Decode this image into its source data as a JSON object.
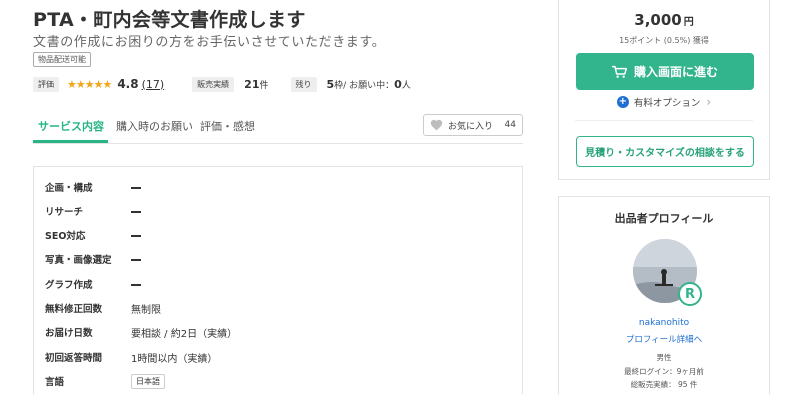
{
  "service": {
    "title": "PTA・町内会等文書作成します",
    "subtitle": "文書の作成にお困りの方をお手伝いさせていただきます。",
    "shipping_badge": "物品配送可能"
  },
  "stats": {
    "rating_tag": "評価",
    "stars": "★★★★★",
    "rating": "4.8",
    "review_count": "(17)",
    "sales_tag": "販売実績",
    "sales_count": "21",
    "sales_unit": "件",
    "slots_tag": "残り",
    "slots_count": "5",
    "slots_unit": "枠",
    "inquiry_label": " / お願い中：",
    "inquiry_count": "0",
    "inquiry_unit": "人"
  },
  "tabs": [
    {
      "label": "サービス内容"
    },
    {
      "label": "購入時のお願い"
    },
    {
      "label": "評価・感想"
    }
  ],
  "favorite": {
    "label": "お気に入り",
    "count": "44"
  },
  "details": [
    {
      "label": "企画・構成",
      "value": ""
    },
    {
      "label": "リサーチ",
      "value": ""
    },
    {
      "label": "SEO対応",
      "value": ""
    },
    {
      "label": "写真・画像選定",
      "value": ""
    },
    {
      "label": "グラフ作成",
      "value": ""
    },
    {
      "label": "無料修正回数",
      "value": "無制限"
    },
    {
      "label": "お届け日数",
      "value": "要相談 / 約2日（実績）"
    },
    {
      "label": "初回返答時間",
      "value": "1時間以内（実績）"
    },
    {
      "label": "言語",
      "value": "日本語"
    }
  ],
  "purchase": {
    "price": "3,000",
    "currency": "円",
    "points": "15ポイント (0.5%) 獲得",
    "buy_label": "購入画面に進む",
    "option_label": "有料オプション",
    "consult_label": "見積り・カスタマイズの相談をする"
  },
  "profile": {
    "heading": "出品者プロフィール",
    "badge": "R",
    "username": "nakanohito",
    "detail_link": "プロフィール詳細へ",
    "gender": "男性",
    "last_login": "最終ログイン：9ヶ月前",
    "total_sales": "総販売実績： 95 件"
  },
  "colors": {
    "accent": "#32b48c",
    "link": "#1e6fd0",
    "star": "#f2a51a"
  },
  "icons": {
    "favorite": "heart-icon",
    "cart": "cart-icon",
    "option": "plus-icon",
    "chevron": "chevron-right-icon"
  }
}
